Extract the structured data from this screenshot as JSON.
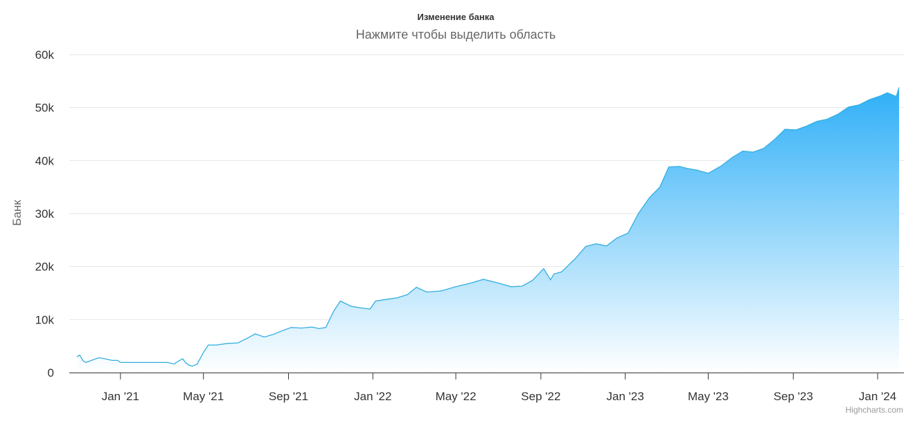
{
  "chart_data": {
    "type": "area",
    "title": "Изменение банка",
    "subtitle": "Нажмите чтобы выделить область",
    "ylabel": "Банк",
    "xlabel": "",
    "credits": "Highcharts.com",
    "ylim": [
      0,
      60000
    ],
    "xlim": [
      "2020-10-19",
      "2024-02-08"
    ],
    "y_ticks": [
      0,
      10000,
      20000,
      30000,
      40000,
      50000,
      60000
    ],
    "y_tick_labels": [
      "0",
      "10k",
      "20k",
      "30k",
      "40k",
      "50k",
      "60k"
    ],
    "x_ticks": [
      "2021-01-01",
      "2021-05-01",
      "2021-09-01",
      "2022-01-01",
      "2022-05-01",
      "2022-09-01",
      "2023-01-01",
      "2023-05-01",
      "2023-09-01",
      "2024-01-01"
    ],
    "x_tick_labels": [
      "Jan '21",
      "May '21",
      "Sep '21",
      "Jan '22",
      "May '22",
      "Sep '22",
      "Jan '23",
      "May '23",
      "Sep '23",
      "Jan '24"
    ],
    "grid": true,
    "colors": {
      "line": "#33aee0",
      "fill_top": "#2eaff7",
      "fill_bottom": "#ffffff",
      "grid": "#e6e6e6",
      "axis": "#333333"
    },
    "series": [
      {
        "x": [
          "2020-10-30",
          "2020-11-03",
          "2020-11-08",
          "2020-11-12",
          "2020-11-20",
          "2020-12-01",
          "2020-12-10",
          "2020-12-20",
          "2020-12-28",
          "2021-01-01",
          "2021-01-20",
          "2021-02-15",
          "2021-03-10",
          "2021-03-20",
          "2021-03-25",
          "2021-04-01",
          "2021-04-05",
          "2021-04-10",
          "2021-04-15",
          "2021-04-22",
          "2021-05-01",
          "2021-05-08",
          "2021-05-20",
          "2021-06-05",
          "2021-06-20",
          "2021-07-05",
          "2021-07-15",
          "2021-07-28",
          "2021-08-10",
          "2021-08-25",
          "2021-09-05",
          "2021-09-20",
          "2021-10-05",
          "2021-10-15",
          "2021-10-25",
          "2021-11-05",
          "2021-11-15",
          "2021-12-01",
          "2021-12-15",
          "2021-12-28",
          "2022-01-05",
          "2022-01-20",
          "2022-02-05",
          "2022-02-20",
          "2022-03-05",
          "2022-03-20",
          "2022-04-10",
          "2022-05-01",
          "2022-05-20",
          "2022-06-10",
          "2022-07-01",
          "2022-07-20",
          "2022-08-05",
          "2022-08-20",
          "2022-09-05",
          "2022-09-15",
          "2022-09-20",
          "2022-10-01",
          "2022-10-20",
          "2022-11-05",
          "2022-11-20",
          "2022-12-05",
          "2022-12-20",
          "2023-01-05",
          "2023-01-20",
          "2023-02-05",
          "2023-02-20",
          "2023-03-05",
          "2023-03-20",
          "2023-04-01",
          "2023-04-15",
          "2023-05-01",
          "2023-05-20",
          "2023-06-05",
          "2023-06-20",
          "2023-07-05",
          "2023-07-20",
          "2023-08-05",
          "2023-08-20",
          "2023-09-05",
          "2023-09-20",
          "2023-10-05",
          "2023-10-20",
          "2023-11-05",
          "2023-11-20",
          "2023-12-05",
          "2023-12-20",
          "2024-01-05",
          "2024-01-15",
          "2024-01-28",
          "2024-02-01"
        ],
        "values": [
          3000,
          3300,
          2200,
          1900,
          2300,
          2800,
          2600,
          2300,
          2300,
          1900,
          1900,
          1900,
          1900,
          1600,
          2100,
          2600,
          1900,
          1400,
          1200,
          1600,
          3800,
          5200,
          5200,
          5500,
          5600,
          6600,
          7300,
          6700,
          7200,
          8000,
          8500,
          8400,
          8600,
          8300,
          8500,
          11500,
          13500,
          12500,
          12200,
          12000,
          13500,
          13800,
          14100,
          14700,
          16100,
          15200,
          15400,
          16200,
          16800,
          17600,
          16900,
          16200,
          16300,
          17400,
          19600,
          17500,
          18600,
          19000,
          21400,
          23800,
          24300,
          23900,
          25400,
          26300,
          30000,
          33000,
          35000,
          38800,
          38900,
          38500,
          38200,
          37600,
          39000,
          40600,
          41800,
          41600,
          42300,
          44000,
          45900,
          45800,
          46500,
          47400,
          47800,
          48800,
          50100,
          50500,
          51500,
          52200,
          52800,
          52100,
          53800
        ]
      }
    ]
  }
}
